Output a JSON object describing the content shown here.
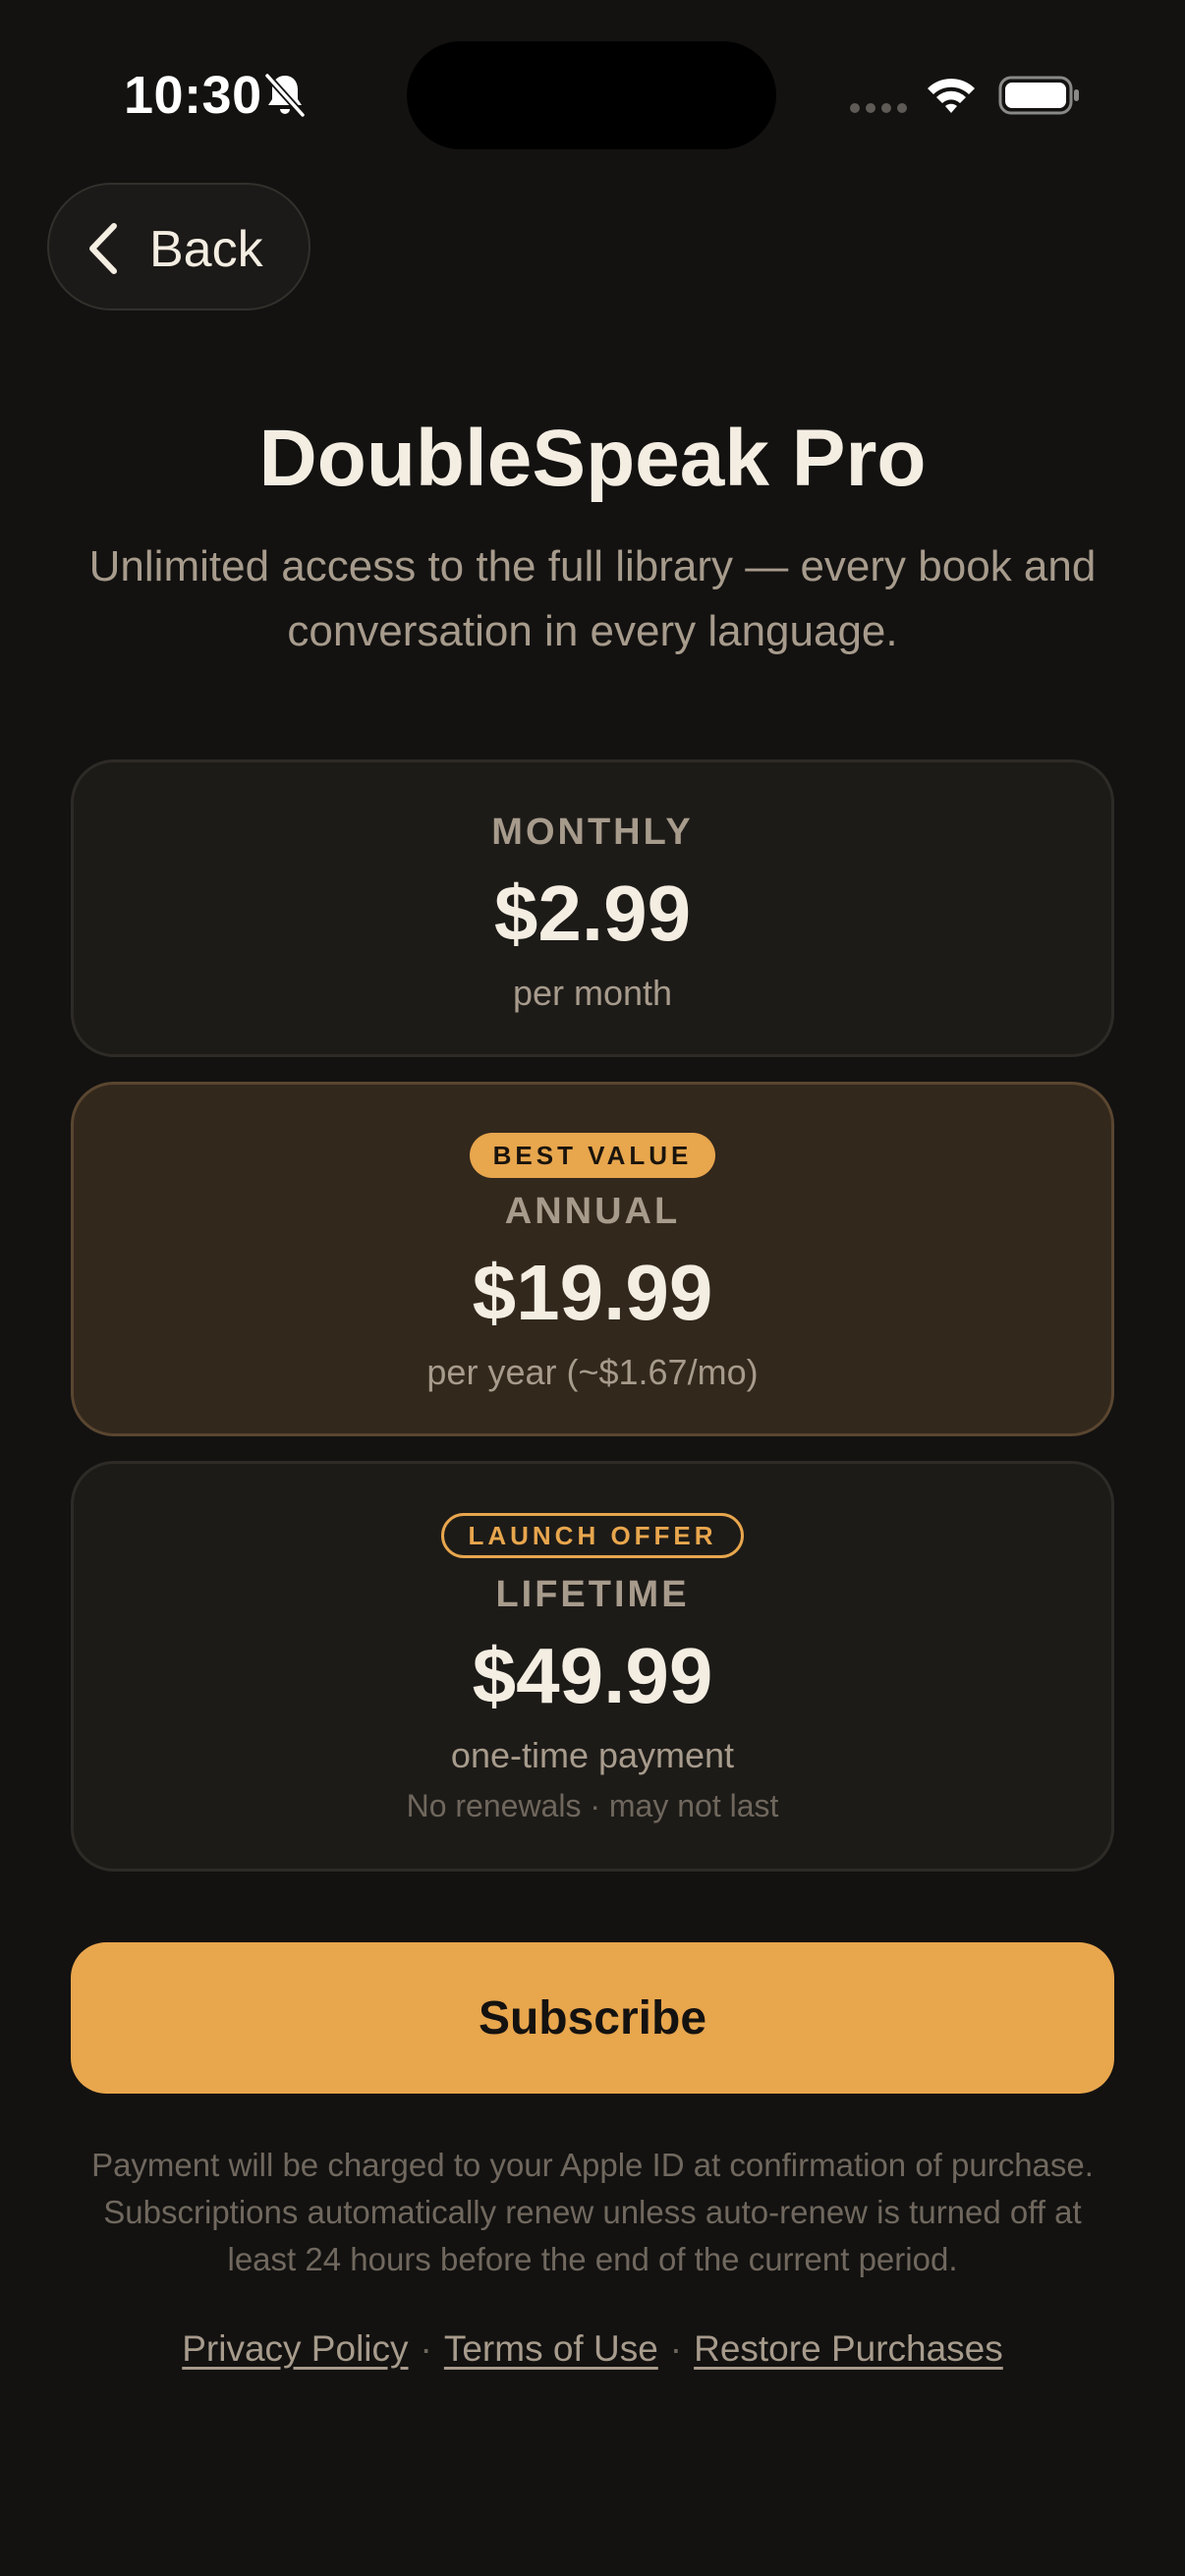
{
  "status_bar": {
    "time": "10:30"
  },
  "nav": {
    "back_label": "Back"
  },
  "header": {
    "title": "DoubleSpeak Pro",
    "subtitle": "Unlimited access to the full library — every book and conversation in every language."
  },
  "plans": [
    {
      "name": "MONTHLY",
      "price": "$2.99",
      "period": "per month",
      "badge": "",
      "note": "",
      "selected": false
    },
    {
      "name": "ANNUAL",
      "price": "$19.99",
      "period": "per year (~$1.67/mo)",
      "badge": "BEST VALUE",
      "note": "",
      "selected": true
    },
    {
      "name": "LIFETIME",
      "price": "$49.99",
      "period": "one-time payment",
      "badge": "LAUNCH OFFER",
      "note": "No renewals · may not last",
      "selected": false
    }
  ],
  "cta": {
    "subscribe_label": "Subscribe"
  },
  "legal": {
    "text": "Payment will be charged to your Apple ID at confirmation of purchase. Subscriptions automatically renew unless auto-renew is turned off at least 24 hours before the end of the current period."
  },
  "links": {
    "privacy": "Privacy Policy",
    "terms": "Terms of Use",
    "restore": "Restore Purchases",
    "separator": "·"
  },
  "colors": {
    "background": "#131211",
    "accent": "#e8a64d",
    "card": "#1d1b18",
    "card_selected": "#33281c",
    "text_primary": "#f4ede2",
    "text_secondary": "#a79b8c"
  },
  "icons": {
    "status": [
      "bell-slash-icon",
      "cellular-signal-icon",
      "wifi-icon",
      "battery-icon"
    ],
    "back": "chevron-left-icon"
  }
}
